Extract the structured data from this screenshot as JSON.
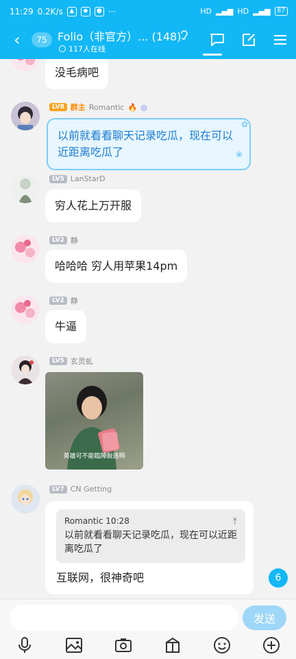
{
  "status_bar": {
    "time": "11:29",
    "speed": "0.2K/s",
    "battery": "87"
  },
  "header": {
    "unread_count": "75",
    "title": "Folio（非官方）... (148)",
    "online": "117人在线"
  },
  "messages": [
    {
      "text": "没毛病吧"
    },
    {
      "level": "LV8",
      "tag": "群主",
      "name": "Romantic",
      "text": "以前就看看聊天记录吃瓜，现在可以近距离吃瓜了"
    },
    {
      "level": "LV5",
      "name": "LanStarD",
      "text": "穷人花上万开服"
    },
    {
      "level": "LV2",
      "name": "静",
      "text": "哈哈哈 穷人用苹果14pm"
    },
    {
      "level": "LV2",
      "name": "静",
      "text": "牛逼"
    },
    {
      "level": "LV5",
      "name": "玄灵虬",
      "image_caption": "英雄可不能臨陣脫逃啊"
    },
    {
      "level": "LV7",
      "name": "CN Getting",
      "quote_header": "Romantic 10:28",
      "quote_text": "以前就看看聊天记录吃瓜，现在可以近距离吃瓜了",
      "text": "互联网，很神奇吧"
    }
  ],
  "new_message_badge": "6",
  "input": {
    "placeholder": "",
    "send_label": "发送"
  },
  "toolbar": [
    "mic-icon",
    "image-icon",
    "camera-icon",
    "gift-icon",
    "emoji-icon",
    "plus-icon"
  ],
  "colors": {
    "brand": "#12b7f5",
    "owner": "#ff8a00",
    "fancy_bubble": "#e7f6ff"
  }
}
